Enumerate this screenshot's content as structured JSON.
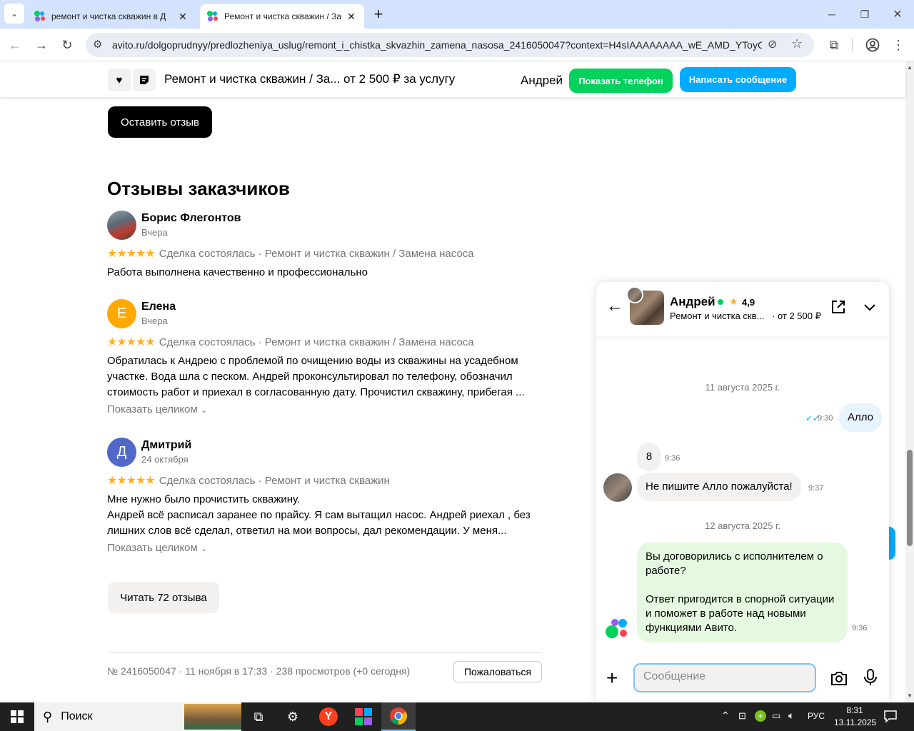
{
  "browser": {
    "tabs": [
      {
        "title": "ремонт и чистка скважин в Д",
        "active": false
      },
      {
        "title": "Ремонт и чистка скважин / За",
        "active": true
      }
    ],
    "new_tab": "+",
    "url": "avito.ru/dolgoprudnyy/predlozheniya_uslug/remont_i_chistka_skvazhin_zamena_nasosa_2416050047?context=H4sIAAAAAAAA_wE_AMD_YToyOn..."
  },
  "sticky": {
    "title": "Ремонт и чистка скважин / За...",
    "price": "от 2 500 ₽ за услугу",
    "seller": "Андрей",
    "phone_button": "Показать телефон",
    "message_button": "Написать сообщение"
  },
  "main": {
    "leave_review": "Оставить отзыв",
    "reviews_title": "Отзывы заказчиков",
    "reviews": [
      {
        "name": "Борис Флегонтов",
        "date": "Вчера",
        "initial": "",
        "stars": "★★★★★",
        "meta": "Сделка состоялась · Ремонт и чистка скважин / Замена насоса",
        "text": "Работа выполнена качественно и профессионально"
      },
      {
        "name": "Елена",
        "date": "Вчера",
        "initial": "Е",
        "stars": "★★★★★",
        "meta": "Сделка состоялась · Ремонт и чистка скважин / Замена насоса",
        "text": "Обратилась к Андрею с проблемой по очищению воды из скважины на усадебном участке. Вода шла с песком. Андрей проконсультировал по телефону, обозначил стоимость работ и приехал в согласованную дату. Прочистил скважину, прибегая ...",
        "show_full": "Показать целиком"
      },
      {
        "name": "Дмитрий",
        "date": "24 октября",
        "initial": "Д",
        "stars": "★★★★★",
        "meta": "Сделка состоялась · Ремонт и чистка скважин",
        "text_line1": "Мне нужно было прочистить скважину.",
        "text_line2": "Андрей всё расписал заранее по прайсу. Я сам вытащил насос. Андрей риехал , без лишних слов всё сделал, ответил на мои вопросы, дал рекомендации. У меня...",
        "show_full": "Показать целиком"
      }
    ],
    "read_all": "Читать 72 отзыва",
    "footer_info": "№ 2416050047 · 11 ноября в 17:33 · 238 просмотров (+0 сегодня)",
    "complain": "Пожаловаться"
  },
  "chat": {
    "name": "Андрей",
    "rating": "4,9",
    "subtitle": "Ремонт и чистка скв...",
    "price": "· от 2 500 ₽",
    "messages": [
      {
        "type": "date",
        "text": "11 августа 2025 г."
      },
      {
        "type": "out",
        "text": "Алло",
        "time": "9:30"
      },
      {
        "type": "in",
        "text": "8",
        "time": "9:36"
      },
      {
        "type": "in",
        "text": "Не пишите Алло пожалуйста!",
        "time": "9:37"
      },
      {
        "type": "date",
        "text": "12 августа 2025 г."
      },
      {
        "type": "system",
        "text_1": "Вы договорились с исполнителем о работе?",
        "text_2": "Ответ пригодится в спорной ситуации и поможет в работе над новыми функциями Авито.",
        "time": "9:36"
      }
    ],
    "input_placeholder": "Сообщение"
  },
  "taskbar": {
    "search_label": "Поиск",
    "language": "РУС",
    "time": "8:31",
    "date": "13.11.2025"
  },
  "colors": {
    "green": "#02d15c",
    "blue": "#00aaff",
    "star": "#ffb021"
  }
}
